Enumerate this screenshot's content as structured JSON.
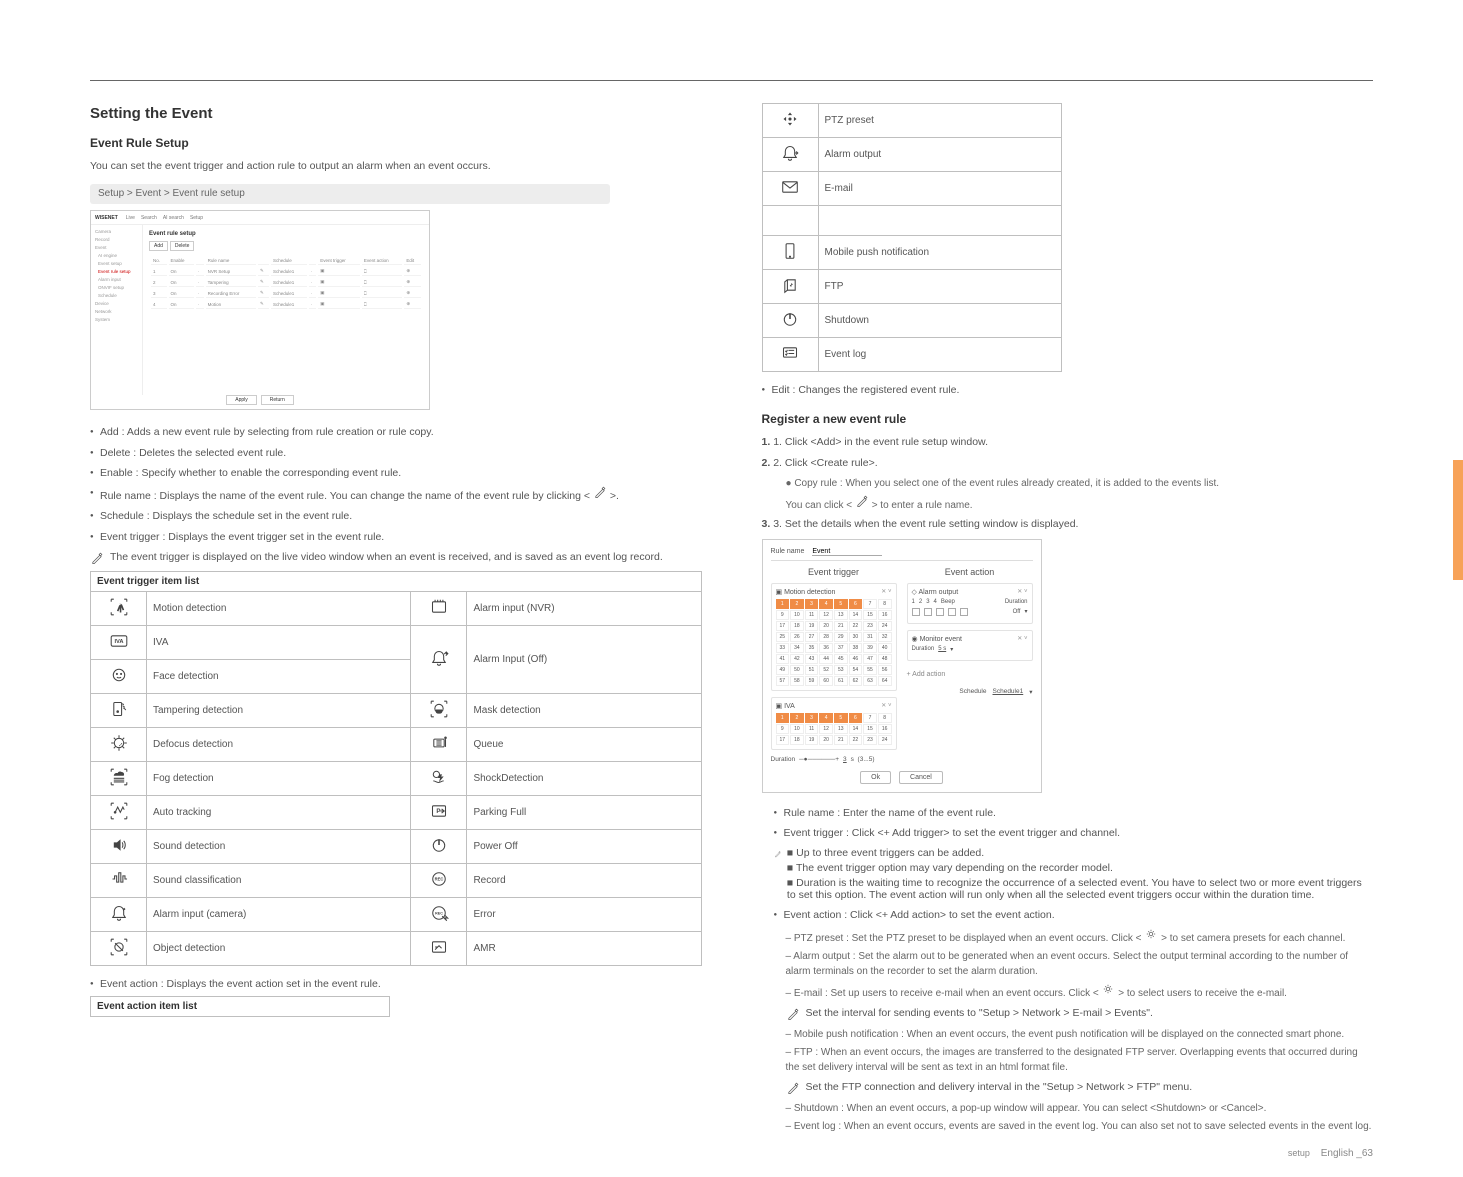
{
  "col1": {
    "section_title": "Setting the Event",
    "sub1": "Event Rule Setup",
    "p1": "You can set the event trigger and action rule to output an alarm when an event occurs.",
    "tab_label": "Setup > Event > Event rule setup",
    "screenshot": {
      "brand": "WISENET",
      "nav": [
        "Live",
        "Search",
        "AI search",
        "Setup"
      ],
      "side": [
        "Camera",
        "Record",
        "Event",
        "AI engine",
        "Event setup",
        "Event rule setup",
        "Alarm input",
        "ONVIF setup",
        "Schedule",
        "Device",
        "Network",
        "System"
      ],
      "title": "Event rule setup",
      "btns": [
        "Add",
        "Delete"
      ],
      "cols": [
        "No.",
        "Enable",
        "Rule name",
        "Schedule",
        "Event trigger",
        "Event action",
        "Edit"
      ],
      "rows": [
        [
          "1",
          "On",
          "NVR Setup",
          "Schedule1"
        ],
        [
          "2",
          "On",
          "Tampering",
          "Schedule1"
        ],
        [
          "3",
          "On",
          "Recording Error",
          "Schedule1"
        ],
        [
          "4",
          "On",
          "Motion",
          "Schedule1"
        ]
      ],
      "foot": [
        "Apply",
        "Return"
      ]
    },
    "b1": "Add : Adds a new event rule by selecting from rule creation or rule copy.",
    "b2": "Delete : Deletes the selected event rule.",
    "b3": "Enable : Specify whether to enable the corresponding event rule.",
    "b4": "Rule name : Displays the name of the event rule. You can change the name of the event rule by clicking < ",
    "b4b": " >.",
    "b5": "Schedule : Displays the schedule set in the event rule.",
    "b6": "Event trigger : Displays the event trigger set in the event rule.",
    "note1": "The event trigger is displayed on the live video window when an event is received, and is saved as an event log record.",
    "table_hdr": "Event trigger item list",
    "icons": {
      "motion": "Motion detection",
      "iva": "IVA",
      "face": "Face detection",
      "tamper": "Tampering detection",
      "defocus": "Defocus detection",
      "fog": "Fog detection",
      "auto": "Auto tracking",
      "sound": "Sound detection",
      "soundcls": "Sound classification",
      "alarmci": "Alarm input (camera)",
      "odet": "Object detection",
      "alarmni": "Alarm input (NVR)",
      "alarmoff": "Alarm Input (Off)",
      "mask": "Mask detection",
      "queue": "Queue",
      "shock": "ShockDetection",
      "parking": "Parking Full",
      "poweroff": "Power Off",
      "rec": "Record",
      "err": "Error",
      "amr": "AMR"
    },
    "b7": "Event action : Displays the event action set in the event rule.",
    "table2_hdr": "Event action item list"
  },
  "col2": {
    "act": {
      "ptz": "PTZ preset",
      "aout": "Alarm output",
      "mail": "E-mail",
      "mob": "Mobile push notification",
      "ftp": "FTP",
      "shutdown": "Shutdown",
      "el": "Event log"
    },
    "b_edit": "Edit : Changes the registered event rule.",
    "sub": "Register a new event rule",
    "s1": "1. Click <Add> in the event rule setup window.",
    "s2": "2. Click <Create rule>.",
    "s2a": "Copy rule : When you select one of the event rules already created, it is added to the events list.",
    "s2b": "You can click < ",
    "s2c": " > to enter a rule name.",
    "s3": "3. Set the details when the event rule setting window is displayed.",
    "dlg": {
      "rulelbl": "Rule name",
      "rulename": "Event",
      "et": "Event trigger",
      "ea": "Event action",
      "md": "Motion detection",
      "ao": "Alarm output",
      "me": "Monitor event",
      "iv": "IVA",
      "beep": "Beep",
      "dur": "Duration",
      "durv": "5 s",
      "off": "Off",
      "add": "+  Add action",
      "sched": "Schedule",
      "schedv": "Schedule1",
      "ok": "Ok",
      "cancel": "Cancel",
      "outs": [
        "1",
        "2",
        "3",
        "4"
      ]
    },
    "li1": "Rule name : Enter the name of the event rule.",
    "li2": "Event trigger : Click <+ Add trigger> to set the event trigger and channel.",
    "n1": "Up to three event triggers can be added.",
    "n2": "The event trigger option may vary depending on the recorder model.",
    "n3": "Duration is the waiting time to recognize the occurrence of a selected event. You have to select two or more event triggers to set this option. The event action will run only when all the selected event triggers occur within the duration time.",
    "li3": "Event action : Click <+ Add action> to set the event action.",
    "ea1": "PTZ preset : Set the PTZ preset to be displayed when an event occurs. Click < ",
    "ea1b": " > to set camera presets for each channel.",
    "ea2": "Alarm output : Set the alarm out to be generated when an event occurs. Select the output terminal according to the number of alarm terminals on the recorder to set the alarm duration.",
    "ea3": "E-mail : Set up users to receive e-mail when an event occurs. Click < ",
    "ea3b": " > to select users to receive the e-mail.",
    "ea3n": "Set the interval for sending events to \"Setup > Network > E-mail > Events\".",
    "ea4": "Mobile push notification : When an event occurs, the event push notification will be displayed on the connected smart phone.",
    "ea5": "FTP : When an event occurs, the images are transferred to the designated FTP server. Overlapping events that occurred during the set delivery interval will be sent as text in an html format file.",
    "ea5n": "Set the FTP connection and delivery interval in the \"Setup > Network > FTP\" menu.",
    "ea6": "Shutdown : When an event occurs, a pop-up window will appear. You can select <Shutdown> or <Cancel>.",
    "ea7": "Event log : When an event occurs, events are saved in the event log. You can also set not to save selected events in the event log."
  },
  "footer": {
    "cat": "setup",
    "page": "English _63"
  }
}
